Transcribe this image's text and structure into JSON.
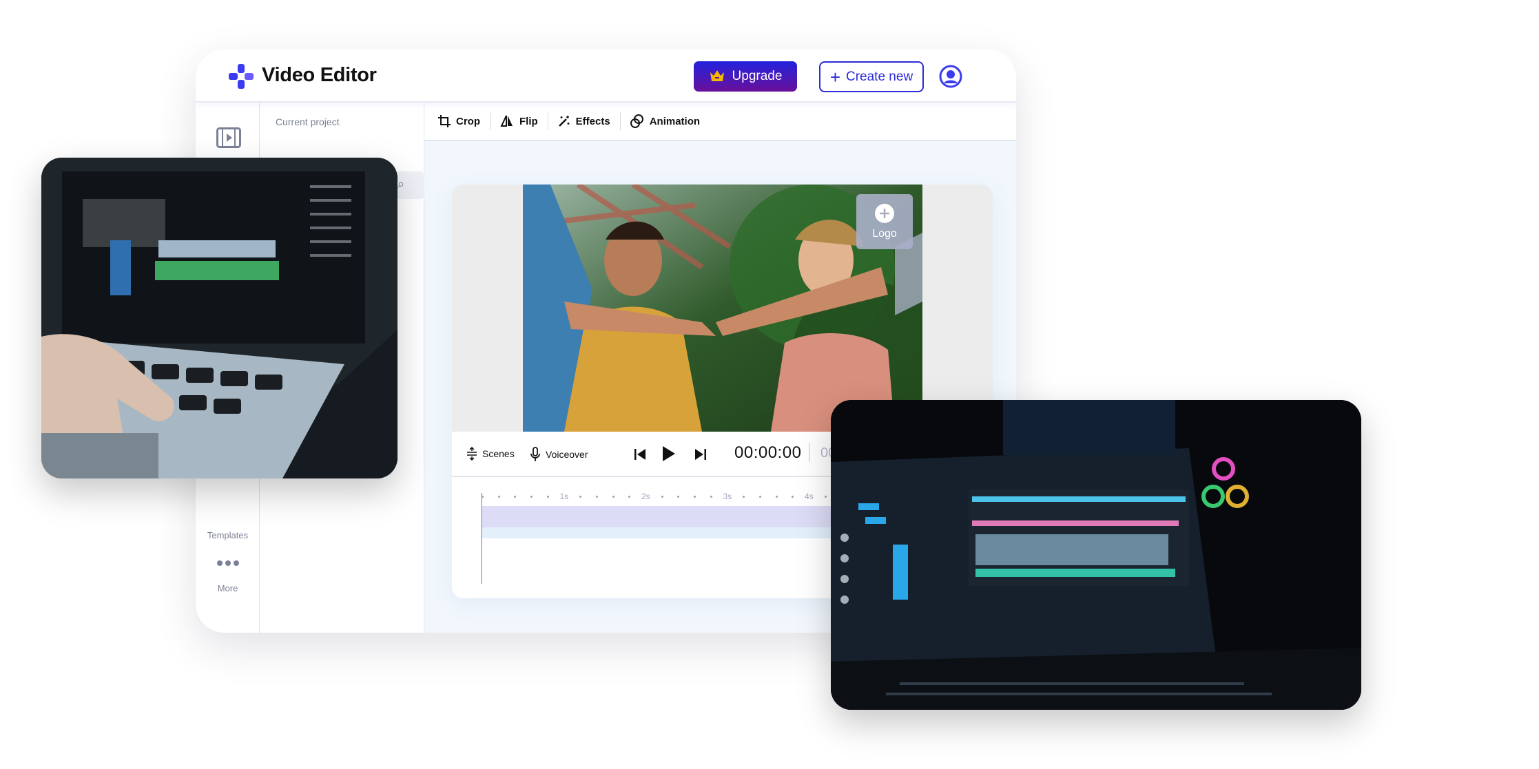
{
  "header": {
    "title": "Video Editor",
    "upgrade_label": "Upgrade",
    "create_new_label": "Create new"
  },
  "sidebar": {
    "items": [
      {
        "label": "Templates",
        "icon": "templates-icon"
      },
      {
        "label": "More",
        "icon": "more-dots-icon"
      }
    ],
    "top_icon": "film-icon"
  },
  "panel": {
    "title": "Current project"
  },
  "toolbar": {
    "items": [
      {
        "label": "Crop",
        "icon": "crop-icon"
      },
      {
        "label": "Flip",
        "icon": "flip-icon"
      },
      {
        "label": "Effects",
        "icon": "magic-wand-icon"
      },
      {
        "label": "Animation",
        "icon": "animation-icon"
      }
    ]
  },
  "stage": {
    "logo_label": "Logo"
  },
  "controls": {
    "scenes_label": "Scenes",
    "voiceover_label": "Voiceover",
    "time": "00:00:00",
    "time_total_partial": "00"
  },
  "timeline": {
    "ticks": [
      "1s",
      "2s",
      "3s",
      "4s"
    ]
  },
  "colors": {
    "accent": "#2b2bd9",
    "upgrade_gradient_start": "#2222dd",
    "upgrade_gradient_end": "#6a0f9a",
    "crown": "#f5b800",
    "track": "#dcdcf6"
  }
}
